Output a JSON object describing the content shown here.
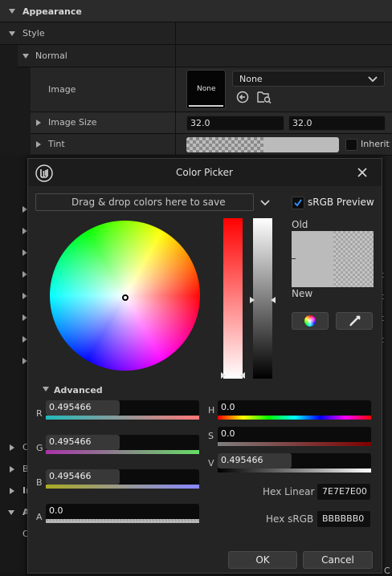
{
  "details": {
    "appearance": "Appearance",
    "style": "Style",
    "normal": "Normal",
    "image_label": "Image",
    "thumbnail_text": "None",
    "image_dropdown": "None",
    "image_size_label": "Image Size",
    "image_size_x": "32.0",
    "image_size_y": "32.0",
    "tint_label": "Tint",
    "inherit_label": "Inherit",
    "side_letters": [
      "C",
      "B",
      "Ir",
      "A",
      "C"
    ],
    "right_inherit": [
      "rit",
      "rit",
      "rit",
      "rit",
      "C"
    ]
  },
  "picker": {
    "title": "Color Picker",
    "drop_zone": "Drag & drop colors here to save",
    "srgb_preview": "sRGB Preview",
    "old_label": "Old",
    "new_label": "New",
    "advanced": "Advanced",
    "r_label": "R",
    "r_value": "0.495466",
    "g_label": "G",
    "g_value": "0.495466",
    "b_label": "B",
    "b_value": "0.495466",
    "a_label": "A",
    "a_value": "0.0",
    "h_label": "H",
    "h_value": "0.0",
    "s_label": "S",
    "s_value": "0.0",
    "v_label": "V",
    "v_value": "0.495466",
    "hex_linear_label": "Hex Linear",
    "hex_linear_value": "7E7E7E00",
    "hex_srgb_label": "Hex sRGB",
    "hex_srgb_value": "BBBBBB0",
    "ok": "OK",
    "cancel": "Cancel",
    "colors": {
      "old_color": "#bbbbbb",
      "new_color": "#bbbbbb",
      "accent": "#1e7fd6"
    }
  }
}
